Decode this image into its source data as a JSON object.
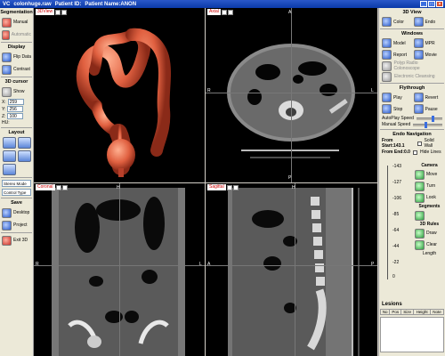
{
  "titlebar": {
    "app": "VC",
    "file": "colonhuge.raw",
    "patient_id_label": "Patient ID:",
    "patient_name": "Patient Name:ANON"
  },
  "left": {
    "segmentation": {
      "title": "Segmentation",
      "manual": "Manual",
      "automatic": "Automatic"
    },
    "display": {
      "title": "Display",
      "flip": "Flip Data",
      "contrast": "Contrast"
    },
    "cursor": {
      "title": "3D cursor",
      "show": "Show",
      "x_label": "X:",
      "x_val": "259",
      "y_label": "Y:",
      "y_val": "256",
      "z_label": "Z:",
      "z_val": "100",
      "hu_label": "HU:"
    },
    "layout": {
      "title": "Layout"
    },
    "stereo_mode": "Stereo Mode",
    "control_type": "Control Type",
    "save": {
      "title": "Save",
      "desktop": "Desktop",
      "project": "Project"
    },
    "exit": "Exit 3D"
  },
  "views": {
    "v3d": {
      "label": "3DView"
    },
    "axial": {
      "label": "Axial",
      "top": "A",
      "left": "R",
      "right": "L",
      "bottom": "P"
    },
    "coronal": {
      "label": "Coronal",
      "top": "H",
      "left": "R",
      "right": "L"
    },
    "sagittal": {
      "label": "Sagittal",
      "top": "H",
      "left": "A",
      "right": "P"
    }
  },
  "right": {
    "view3d": {
      "title": "3D View",
      "color": "Color",
      "endo": "Endo"
    },
    "windows": {
      "title": "Windows",
      "model": "Model",
      "mpr": "MPR",
      "report": "Report",
      "movie": "Movie",
      "polyp": "Polyp Radio Colonoscope",
      "cleansing": "Electronic Cleansing"
    },
    "flythrough": {
      "title": "Flythrough",
      "play": "Play",
      "revert": "Revert",
      "stop": "Stop",
      "pause": "Pause",
      "autoplay": "AutoPlay Speed",
      "manual": "Manual Speed"
    },
    "endnav": {
      "title": "Endo Navigation",
      "from_start": "From Start:143.1",
      "solid_wall": "Solid Wall",
      "from_end": "From End:0.0",
      "hide_lines": "Hide Lines"
    },
    "scale": [
      "-143",
      "-127",
      "-106",
      "-85",
      "-64",
      "-44",
      "-22",
      "0"
    ],
    "camera": {
      "title": "Camera",
      "move": "Move",
      "turn": "Turn",
      "look": "Look"
    },
    "segments": {
      "title": "Segments"
    },
    "rulers": {
      "title": "3D Rules",
      "draw": "Draw",
      "clear": "Clear",
      "length": "Length"
    },
    "lesions": {
      "title": "Lesions",
      "cols": [
        "No",
        "Pos",
        "Size",
        "Height",
        "Note"
      ]
    }
  },
  "colors": {
    "titlebar": "#0a3aa8",
    "panel": "#ece9d8",
    "colon": "#e06040"
  }
}
